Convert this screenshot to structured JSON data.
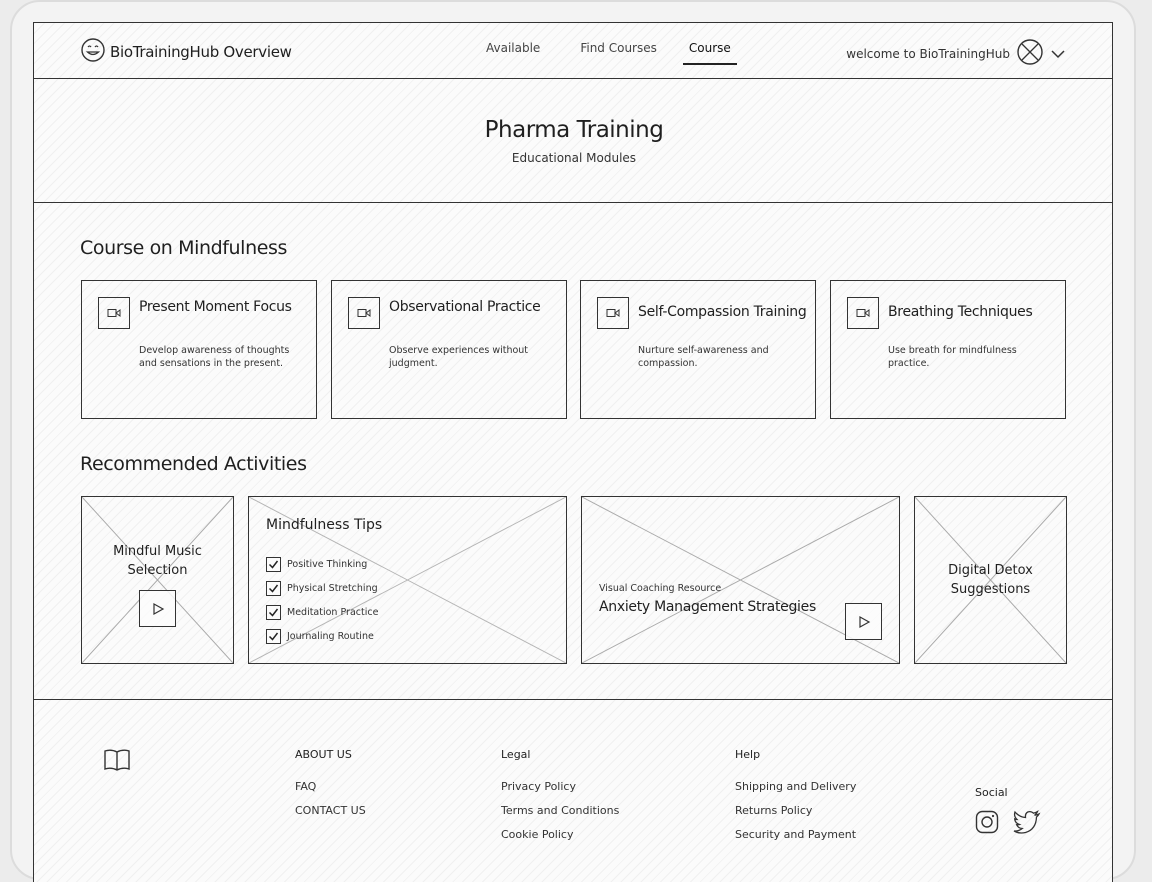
{
  "header": {
    "app_title": "BioTrainingHub Overview",
    "nav": [
      {
        "label": "Available"
      },
      {
        "label": "Find Courses"
      },
      {
        "label": "Course"
      }
    ],
    "welcome": "welcome to BioTrainingHub"
  },
  "hero": {
    "title": "Pharma Training",
    "subtitle": "Educational Modules"
  },
  "courses": {
    "title": "Course on Mindfulness",
    "items": [
      {
        "title": "Present Moment Focus",
        "desc": "Develop awareness of thoughts and sensations in the present.",
        "icon": "video-icon"
      },
      {
        "title": "Observational Practice",
        "desc": "Observe experiences without judgment.",
        "icon": "video-icon"
      },
      {
        "title": "Self-Compassion Training",
        "desc": "Nurture self-awareness and compassion.",
        "icon": "video-icon"
      },
      {
        "title": "Breathing Techniques",
        "desc": "Use breath for mindfulness practice.",
        "icon": "video-icon"
      }
    ]
  },
  "activities": {
    "title": "Recommended Activities",
    "music": "Mindful Music Selection",
    "tips": {
      "title": "Mindfulness Tips",
      "items": [
        "Positive Thinking",
        "Physical Stretching",
        "Meditation Practice",
        "Journaling Routine"
      ]
    },
    "resource": {
      "label": "Visual Coaching Resource",
      "title": "Anxiety Management Strategies"
    },
    "detox": "Digital Detox Suggestions"
  },
  "footer": {
    "about": {
      "heading": "ABOUT US",
      "links": [
        "FAQ",
        "CONTACT US"
      ]
    },
    "legal": {
      "heading": "Legal",
      "links": [
        "Privacy Policy",
        "Terms and Conditions",
        "Cookie Policy"
      ]
    },
    "help": {
      "heading": "Help",
      "links": [
        "Shipping and Delivery",
        "Returns Policy",
        "Security and Payment"
      ]
    },
    "social": {
      "heading": "Social",
      "icons": [
        "instagram-icon",
        "twitter-icon"
      ]
    }
  }
}
